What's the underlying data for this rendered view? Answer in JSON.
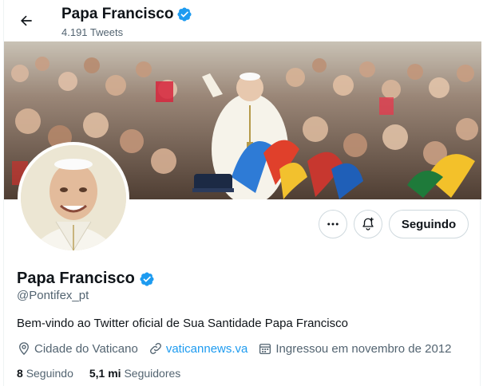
{
  "header": {
    "name": "Papa Francisco",
    "tweet_count": "4.191 Tweets"
  },
  "profile": {
    "name": "Papa Francisco",
    "handle": "@Pontifex_pt",
    "bio": "Bem-vindo ao Twitter oficial de Sua Santidade Papa Francisco",
    "location": "Cidade do Vaticano",
    "website": "vaticannews.va",
    "joined": "Ingressou em novembro de 2012"
  },
  "actions": {
    "follow_label": "Seguindo"
  },
  "stats": {
    "following_count": "8",
    "following_label": "Seguindo",
    "followers_count": "5,1 mi",
    "followers_label": "Seguidores"
  },
  "icons": {
    "back": "arrow-left-icon",
    "verified": "verified-badge-icon",
    "more": "more-horizontal-icon",
    "notify": "bell-plus-icon",
    "location": "location-pin-icon",
    "link": "link-icon",
    "calendar": "calendar-icon"
  },
  "colors": {
    "accent": "#1d9bf0",
    "secondary_text": "#536471",
    "primary_text": "#0f1419"
  }
}
